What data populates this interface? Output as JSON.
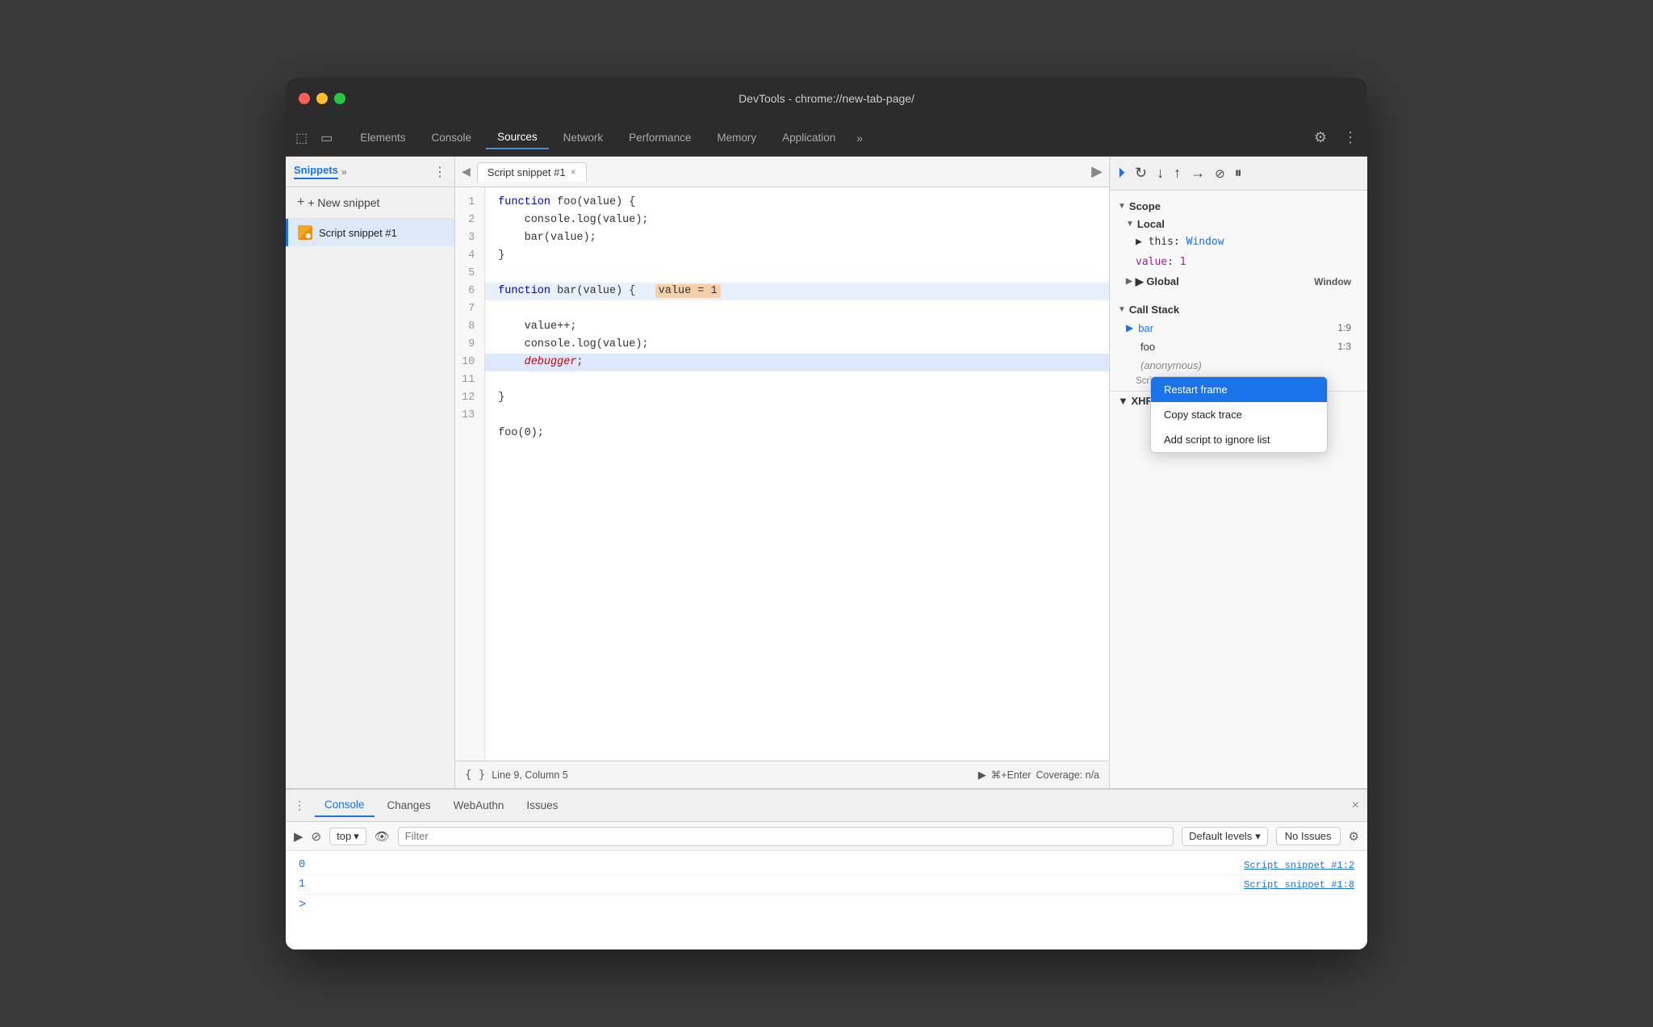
{
  "window": {
    "title": "DevTools - chrome://new-tab-page/",
    "traffic_lights": [
      "red",
      "yellow",
      "green"
    ]
  },
  "tabs": {
    "items": [
      {
        "label": "Elements",
        "active": false
      },
      {
        "label": "Console",
        "active": false
      },
      {
        "label": "Sources",
        "active": true
      },
      {
        "label": "Network",
        "active": false
      },
      {
        "label": "Performance",
        "active": false
      },
      {
        "label": "Memory",
        "active": false
      },
      {
        "label": "Application",
        "active": false
      }
    ],
    "more_label": "»",
    "settings_icon": "⚙",
    "more_icon": "⋮"
  },
  "left_panel": {
    "tab_label": "Snippets",
    "chevron": "»",
    "more": "⋮",
    "new_snippet_label": "+ New snippet",
    "snippet_item_label": "Script snippet #1"
  },
  "editor": {
    "tab_label": "Script snippet #1",
    "close_icon": "×",
    "run_icon": "▶",
    "back_icon": "◀",
    "status": {
      "line_col": "Line 9, Column 5",
      "run_hint": "⌘+Enter",
      "coverage": "Coverage: n/a"
    },
    "code_lines": [
      {
        "num": 1,
        "text": "function foo(value) {"
      },
      {
        "num": 2,
        "text": "    console.log(value);"
      },
      {
        "num": 3,
        "text": "    bar(value);"
      },
      {
        "num": 4,
        "text": "}"
      },
      {
        "num": 5,
        "text": ""
      },
      {
        "num": 6,
        "text": "function bar(value) {   value = 1",
        "highlight": true
      },
      {
        "num": 7,
        "text": "    value++;"
      },
      {
        "num": 8,
        "text": "    console.log(value);"
      },
      {
        "num": 9,
        "text": "    debugger;",
        "debugger_line": true
      },
      {
        "num": 10,
        "text": "}"
      },
      {
        "num": 11,
        "text": ""
      },
      {
        "num": 12,
        "text": "foo(0);"
      },
      {
        "num": 13,
        "text": ""
      }
    ]
  },
  "right_panel": {
    "scope": {
      "header": "Scope",
      "local": {
        "label": "Local",
        "items": [
          {
            "key": "▶ this",
            "sep": ": ",
            "val": "Window"
          },
          {
            "key": "value",
            "sep": ": ",
            "val": "1",
            "color": "magenta"
          }
        ]
      },
      "global": {
        "label": "▶ Global",
        "val": "Window"
      }
    },
    "callstack": {
      "header": "Call Stack",
      "items": [
        {
          "label": "bar",
          "loc": "1:9",
          "active": true
        },
        {
          "label": "foo",
          "loc": "1:3"
        },
        {
          "label": "(anonymous)",
          "loc": ""
        },
        {
          "label": "Script snippet #1:12",
          "is_ref": true
        }
      ]
    },
    "xhrfetch": "▼ XHR/fetch Breakpoints"
  },
  "context_menu": {
    "items": [
      {
        "label": "Restart frame",
        "selected": true
      },
      {
        "label": "Copy stack trace",
        "selected": false
      },
      {
        "label": "Add script to ignore list",
        "selected": false
      }
    ]
  },
  "bottom_panel": {
    "tabs": [
      {
        "label": "Console",
        "active": true
      },
      {
        "label": "Changes",
        "active": false
      },
      {
        "label": "WebAuthn",
        "active": false
      },
      {
        "label": "Issues",
        "active": false
      }
    ],
    "close_icon": "×",
    "more_icon": "⋮",
    "toolbar": {
      "execute_icon": "▶",
      "block_icon": "⊘",
      "top_label": "top",
      "top_arrow": "▾",
      "eye_icon": "👁",
      "filter_placeholder": "Filter",
      "levels_label": "Default levels",
      "levels_arrow": "▾",
      "no_issues_label": "No Issues",
      "settings_icon": "⚙"
    },
    "console_lines": [
      {
        "val": "0",
        "ref": "Script snippet #1:2"
      },
      {
        "val": "1",
        "ref": "Script snippet #1:8"
      }
    ],
    "prompt": ">"
  }
}
